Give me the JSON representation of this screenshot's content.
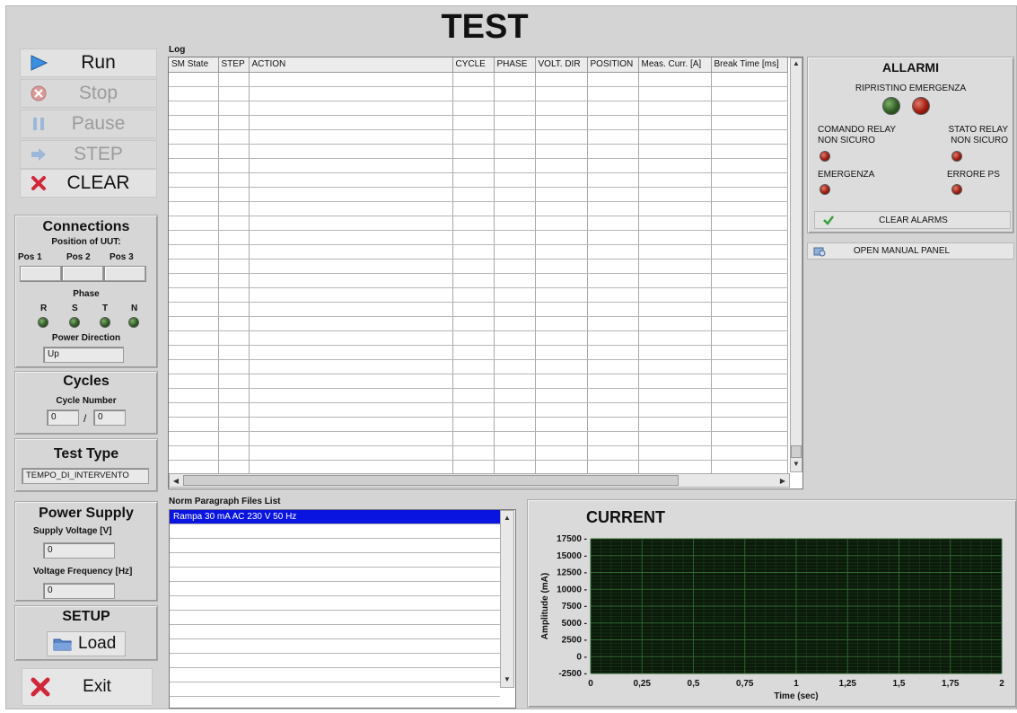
{
  "title": "TEST",
  "controls": {
    "run": "Run",
    "stop": "Stop",
    "pause": "Pause",
    "step": "STEP",
    "clear": "CLEAR"
  },
  "connections": {
    "title": "Connections",
    "position_label": "Position of UUT:",
    "pos1": "Pos 1",
    "pos2": "Pos 2",
    "pos3": "Pos 3",
    "phase_label": "Phase",
    "phases": [
      "R",
      "S",
      "T",
      "N"
    ],
    "power_direction_label": "Power Direction",
    "power_direction_value": "Up"
  },
  "cycles": {
    "title": "Cycles",
    "cycle_number_label": "Cycle Number",
    "current": "0",
    "separator": "/",
    "total": "0"
  },
  "test_type": {
    "title": "Test Type",
    "value": "TEMPO_DI_INTERVENTO"
  },
  "power_supply": {
    "title": "Power Supply",
    "supply_voltage_label": "Supply Voltage [V]",
    "supply_voltage_value": "0",
    "voltage_frequency_label": "Voltage Frequency [Hz]",
    "voltage_frequency_value": "0"
  },
  "setup": {
    "title": "SETUP",
    "load_label": "Load"
  },
  "exit_label": "Exit",
  "log": {
    "label": "Log",
    "columns": [
      "SM State",
      "STEP",
      "ACTION",
      "CYCLE",
      "PHASE",
      "VOLT. DIR",
      "POSITION",
      "Meas. Curr. [A]",
      "Break Time [ms]"
    ]
  },
  "alarms": {
    "title": "ALLARMI",
    "ripristino_label": "RIPRISTINO EMERGENZA",
    "comando_relay_label": "COMANDO RELAY NON SICURO",
    "stato_relay_label": "STATO RELAY NON SICURO",
    "emergenza_label": "EMERGENZA",
    "errore_ps_label": "ERRORE PS",
    "clear_alarms_label": "CLEAR ALARMS"
  },
  "open_manual_panel_label": "OPEN MANUAL PANEL",
  "norm_files": {
    "label": "Norm Paragraph Files List",
    "items": [
      "Rampa 30 mA AC 230 V 50 Hz"
    ]
  },
  "chart_data": {
    "type": "line",
    "title": "CURRENT",
    "xlabel": "Time (sec)",
    "ylabel": "Amplitude (mA)",
    "xlim": [
      0,
      2
    ],
    "ylim": [
      -2500,
      17500
    ],
    "x_ticks": [
      "0",
      "0,25",
      "0,5",
      "0,75",
      "1",
      "1,25",
      "1,5",
      "1,75",
      "2"
    ],
    "y_ticks": [
      "17500",
      "15000",
      "12500",
      "10000",
      "7500",
      "5000",
      "2500",
      "0",
      "-2500"
    ],
    "series": [],
    "grid": true,
    "plot_background": "#0b1a0b",
    "grid_color": "#2f6b2f"
  },
  "colors": {
    "selection_blue": "#0a14e0",
    "led_green": "#2f5d24",
    "led_red": "#a01b10",
    "run_blue": "#3a8fe0",
    "clear_red": "#d0283a"
  }
}
